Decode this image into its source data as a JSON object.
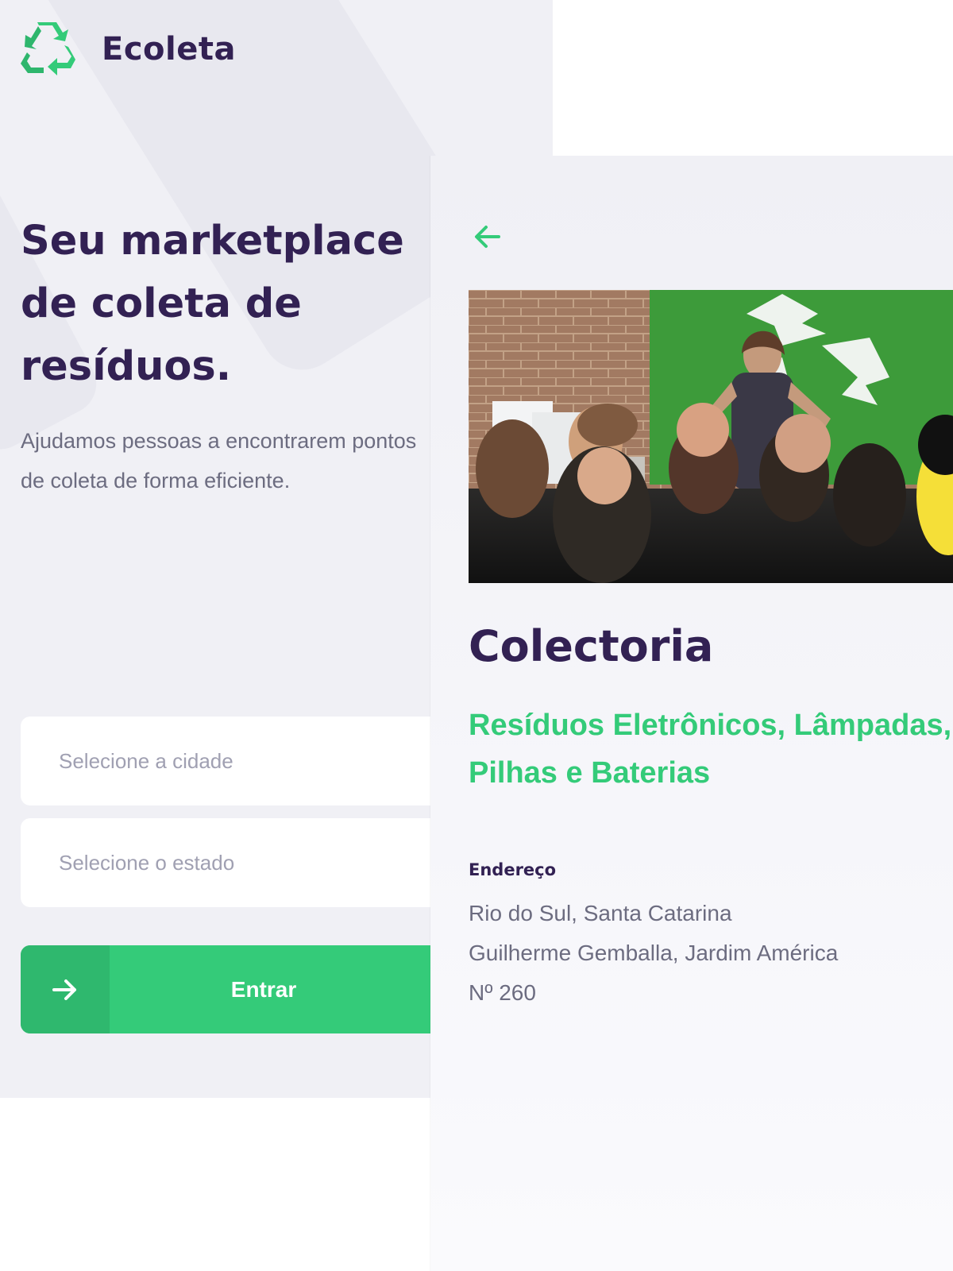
{
  "app": {
    "name": "Ecoleta"
  },
  "home": {
    "title": "Seu marketplace de coleta de resíduos.",
    "subtitle": "Ajudamos pessoas a encontrarem pontos de coleta de forma eficiente.",
    "city_placeholder": "Selecione a cidade",
    "state_placeholder": "Selecione o estado",
    "enter_label": "Entrar",
    "icons": {
      "logo": "recycle-logo-icon",
      "enter": "arrow-right-icon"
    }
  },
  "detail": {
    "name": "Colectoria",
    "items": "Resíduos Eletrônicos, Lâmpadas, Pilhas e Baterias",
    "address_title": "Endereço",
    "address_city": "Rio do Sul, Santa Catarina",
    "address_street": "Guilherme Gemballa, Jardim América",
    "address_number": "Nº 260",
    "icons": {
      "back": "arrow-left-icon"
    },
    "image": "presentation-photo"
  },
  "colors": {
    "primary_text": "#322153",
    "accent_green": "#34cb79",
    "secondary_text": "#6c6c80",
    "background": "#f0f0f5"
  }
}
